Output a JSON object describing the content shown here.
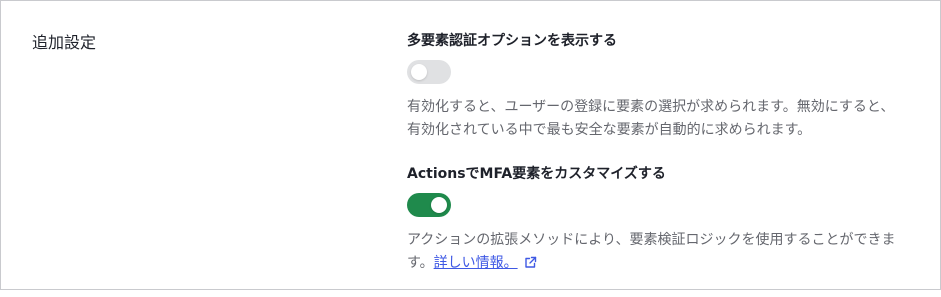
{
  "section": {
    "title": "追加設定"
  },
  "settings": [
    {
      "label": "多要素認証オプションを表示する",
      "enabled": false,
      "description": "有効化すると、ユーザーの登録に要素の選択が求められます。無効にすると、有効化されている中で最も安全な要素が自動的に求められます。"
    },
    {
      "label": "ActionsでMFA要素をカスタマイズする",
      "enabled": true,
      "description": "アクションの拡張メソッドにより、要素検証ロジックを使用することができます。",
      "link_text": "詳しい情報。",
      "link_icon": "external-link-icon"
    }
  ],
  "colors": {
    "toggle_on": "#1f8a4c",
    "toggle_off": "#e0e1e3",
    "link": "#3f59e4",
    "border": "#c9cace"
  }
}
